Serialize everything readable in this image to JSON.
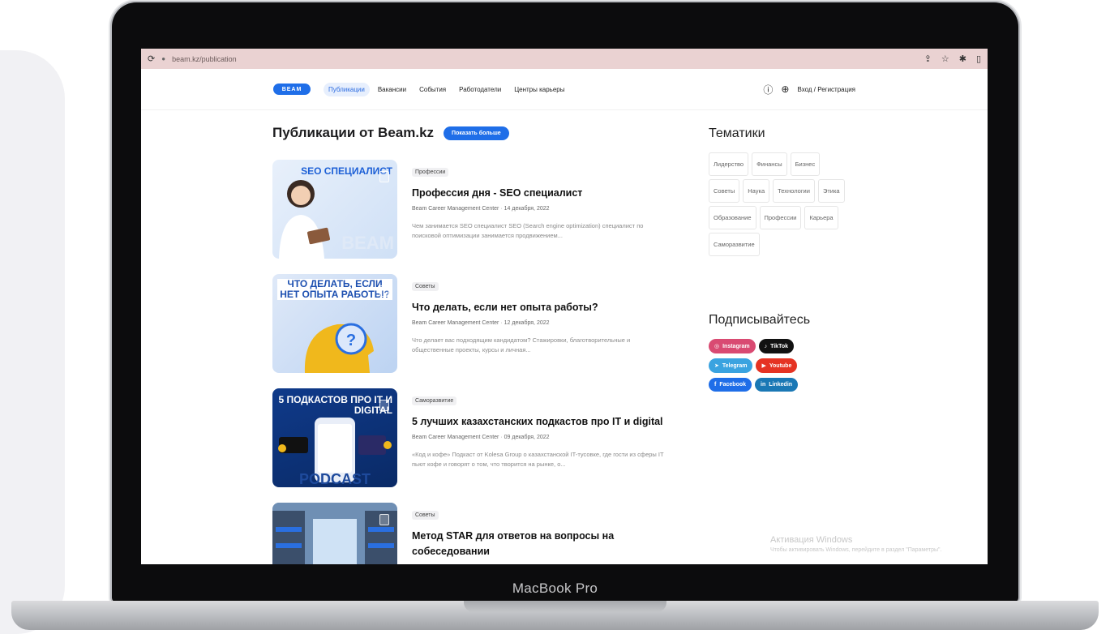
{
  "browser": {
    "url": "beam.kz/publication"
  },
  "site": {
    "logo": "BEAM",
    "nav": [
      "Публикации",
      "Вакансии",
      "События",
      "Работодатели",
      "Центры карьеры"
    ],
    "login": "Вход / Регистрация"
  },
  "publications": {
    "title": "Публикации от Beam.kz",
    "more_button": "Показать больше",
    "articles": [
      {
        "tag": "Профессии",
        "title": "Профессия дня - SEO специалист",
        "author": "Beam Career Management Center",
        "date": "14 декабря, 2022",
        "desc": "Чем занимается SEO специалист SEO (Search engine optimization) специалист по поисковой оптимизации занимается продвижением...",
        "thumb_caption": "SEO СПЕЦИАЛИСТ"
      },
      {
        "tag": "Советы",
        "title": "Что делать, если нет опыта работы?",
        "author": "Beam Career Management Center",
        "date": "12 декабря, 2022",
        "desc": "Что делает вас подходящим кандидатом? Стажировки, благотворительные и общественные проекты, курсы и личная...",
        "thumb_caption": "ЧТО ДЕЛАТЬ, ЕСЛИ НЕТ ОПЫТА РАБОТЫ?"
      },
      {
        "tag": "Саморазвитие",
        "title": "5 лучших казахстанских подкастов про IT и digital",
        "author": "Beam Career Management Center",
        "date": "09 декабря, 2022",
        "desc": "«Код и кофе» Подкаст от Kolesa Group о казахстанской IT-тусовке, где гости из сферы IT пьют кофе и говорят о том, что творится на рынке, о...",
        "thumb_caption": "5 ПОДКАСТОВ ПРО IT И DIGITAL"
      },
      {
        "tag": "Советы",
        "title": "Метод STAR для ответов на вопросы на собеседовании",
        "author": "",
        "date": "",
        "desc": "",
        "thumb_caption": ""
      }
    ]
  },
  "themes": {
    "title": "Тематики",
    "tags": [
      "Лидерство",
      "Финансы",
      "Бизнес",
      "Советы",
      "Наука",
      "Технологии",
      "Этика",
      "Образование",
      "Профессии",
      "Карьера",
      "Саморазвитие"
    ]
  },
  "subscribe": {
    "title": "Подписывайтесь",
    "links": [
      {
        "label": "Instagram",
        "icon": "instagram-icon",
        "color": "#d94a72"
      },
      {
        "label": "TikTok",
        "icon": "tiktok-icon",
        "color": "#111111"
      },
      {
        "label": "Telegram",
        "icon": "telegram-icon",
        "color": "#3aa3e0"
      },
      {
        "label": "Youtube",
        "icon": "youtube-icon",
        "color": "#e53323"
      },
      {
        "label": "Facebook",
        "icon": "facebook-icon",
        "color": "#1f6ee8"
      },
      {
        "label": "Linkedin",
        "icon": "linkedin-icon",
        "color": "#1a78b5"
      }
    ]
  },
  "watermark": {
    "line1": "Активация Windows",
    "line2": "Чтобы активировать Windows, перейдите в раздел \"Параметры\"."
  },
  "device": {
    "label": "MacBook Pro"
  }
}
